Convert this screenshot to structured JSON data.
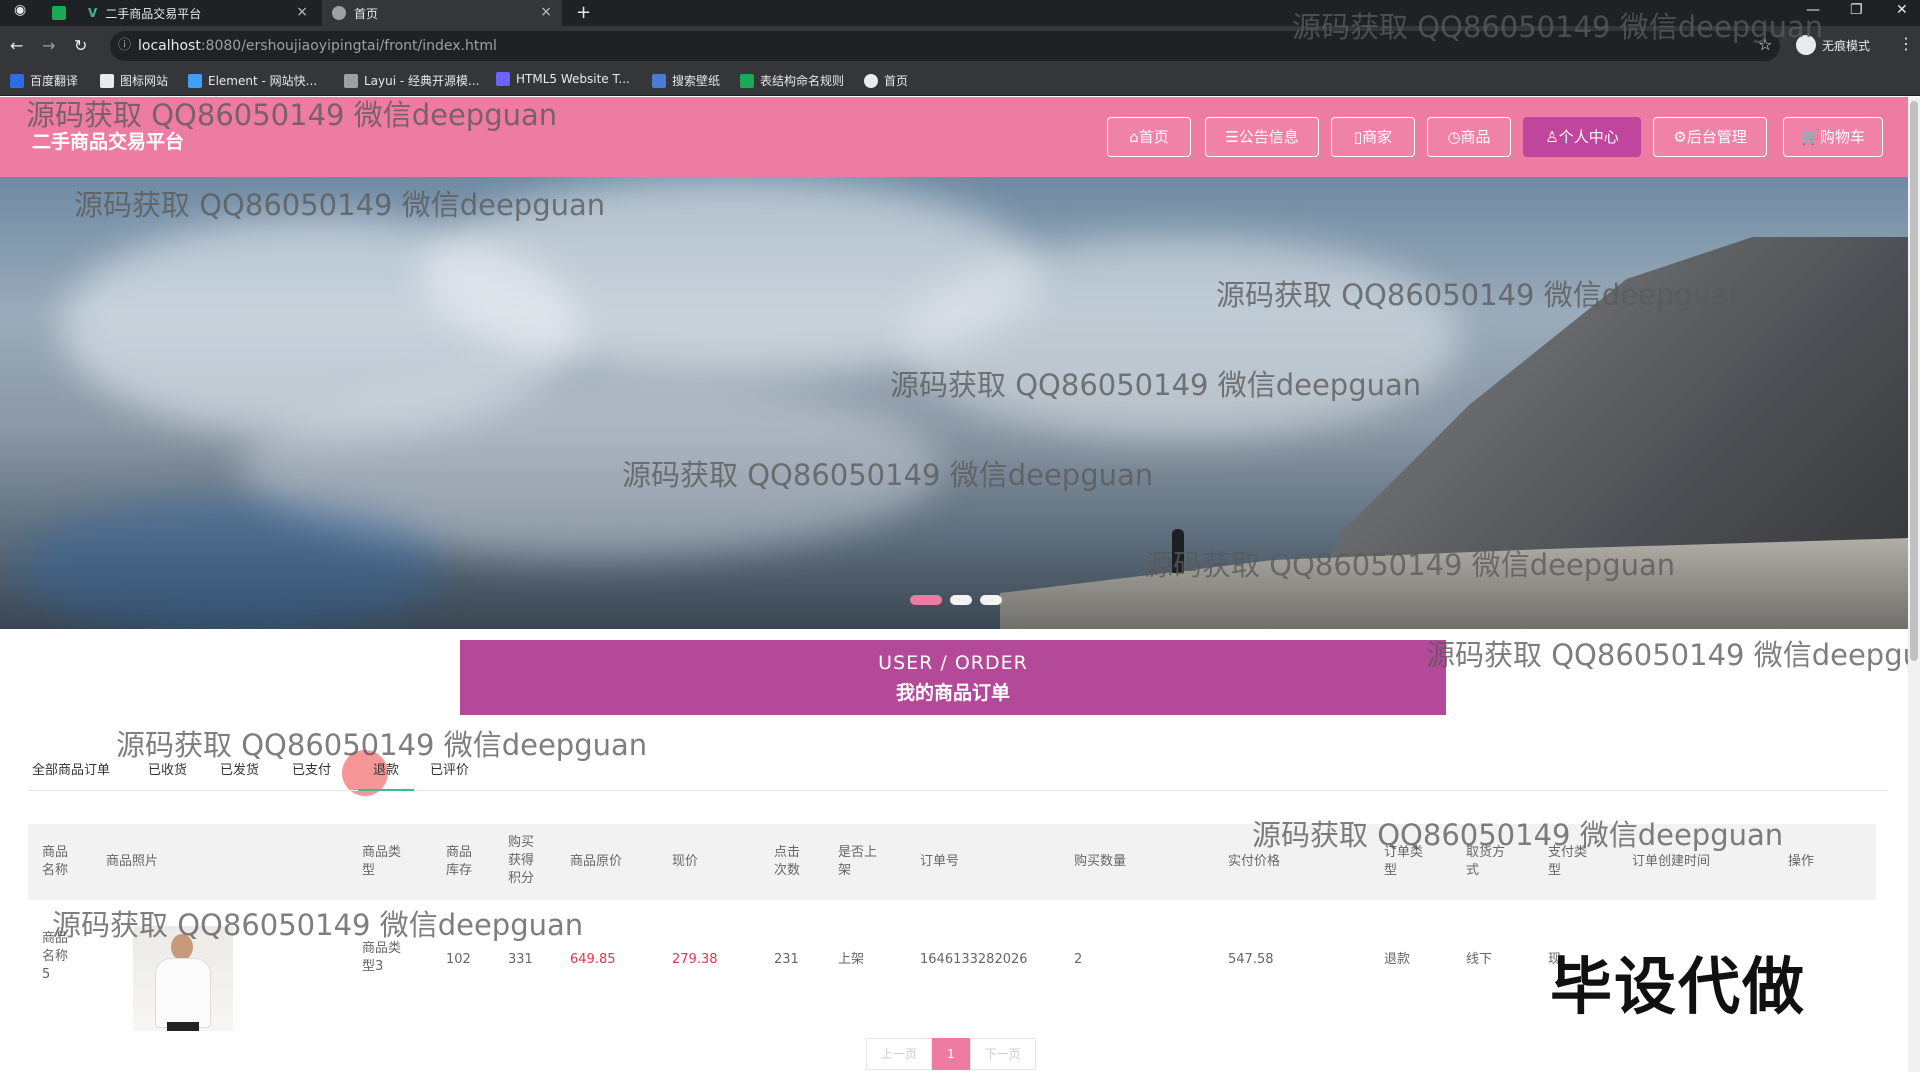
{
  "browser": {
    "tabs": [
      {
        "title": "二手商品交易平台",
        "active": false
      },
      {
        "title": "首页",
        "active": true
      }
    ],
    "url_host": "localhost",
    "url_path": ":8080/ershoujiaoyipingtai/front/index.html",
    "profile_label": "无痕模式",
    "bookmarks": [
      "百度翻译",
      "图标网站",
      "Element - 网站快...",
      "Layui - 经典开源模...",
      "HTML5 Website T...",
      "搜索壁纸",
      "表结构命名规则",
      "首页"
    ]
  },
  "site": {
    "logo": "二手商品交易平台",
    "nav": [
      {
        "label": "⌂首页",
        "active": false
      },
      {
        "label": "☰公告信息",
        "active": false
      },
      {
        "label": "▯商家",
        "active": false
      },
      {
        "label": "◷商品",
        "active": false
      },
      {
        "label": "♙个人中心",
        "active": true
      },
      {
        "label": "⚙后台管理",
        "active": false
      },
      {
        "label": "🛒购物车",
        "active": false
      }
    ],
    "accent_color": "#ee7ba1",
    "active_color": "#c0459d"
  },
  "section": {
    "title_en": "USER / ORDER",
    "title_cn": "我的商品订单"
  },
  "order_tabs": [
    {
      "label": "全部商品订单",
      "active": false
    },
    {
      "label": "已收货",
      "active": false
    },
    {
      "label": "已发货",
      "active": false
    },
    {
      "label": "已支付",
      "active": false
    },
    {
      "label": "退款",
      "active": true
    },
    {
      "label": "已评价",
      "active": false
    }
  ],
  "table": {
    "headers": [
      "商品\n名称",
      "商品照片",
      "商品类\n型",
      "商品\n库存",
      "购买\n获得\n积分",
      "商品原价",
      "现价",
      "点击\n次数",
      "是否上\n架",
      "订单号",
      "购买数量",
      "实付价格",
      "订单类\n型",
      "取货方\n式",
      "支付类\n型",
      "订单创建时间",
      "操作"
    ],
    "rows": [
      {
        "name": "商品\n名称\n5",
        "type": "商品类\n型3",
        "stock": "102",
        "points": "331",
        "original_price": "649.85",
        "price": "279.38",
        "clicks": "231",
        "on_shelf": "上架",
        "order_no": "1646133282026",
        "quantity": "2",
        "paid": "547.58",
        "order_type": "退款",
        "pickup": "线下",
        "pay_type": "现"
      }
    ]
  },
  "pager": {
    "prev": "上一页",
    "current": "1",
    "next": "下一页"
  },
  "watermark_text": "源码获取 QQ86050149 微信deepguan",
  "stamp_text": "毕设代做"
}
